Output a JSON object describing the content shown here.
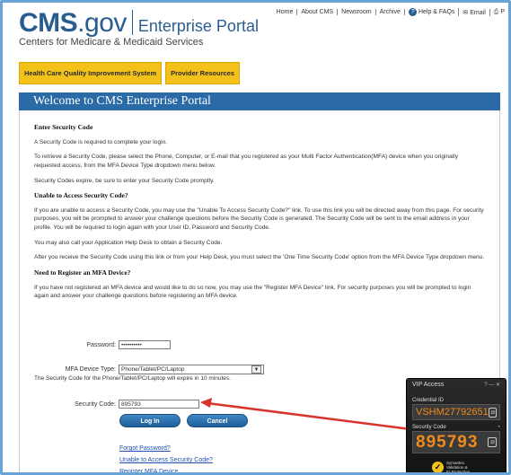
{
  "header": {
    "logo_cms": "CMS",
    "logo_gov": ".gov",
    "portal_title": "Enterprise Portal",
    "subtitle": "Centers for Medicare & Medicaid Services"
  },
  "topnav": {
    "home": "Home",
    "about": "About CMS",
    "newsroom": "Newsroom",
    "archive": "Archive",
    "help": "Help & FAQs",
    "email": "Email",
    "print": "P"
  },
  "tabs": [
    "Health Care Quality Improvement System",
    "Provider Resources"
  ],
  "banner": "Welcome to CMS Enterprise Portal",
  "content": {
    "h_enter": "Enter Security Code",
    "p1": "A Security Code is required to complete your login.",
    "p2": "To retrieve a Security Code, please select the Phone, Computer, or E-mail that you registered as your Multi Factor Authentication(MFA) device when you originally requested access, from the MFA Device Type dropdown menu below.",
    "p3": "Security Codes expire, be sure to enter your Security Code promptly.",
    "h_unable": "Unable to Access Security Code?",
    "p4": "If you are unable to access a Security Code, you may use the \"Unable To Access Security Code?\" link. To use this link you will be directed away from this page. For security purposes, you will be prompted to answer your challenge questions before the Security Code is generated. The Security Code will be sent to the email address in your profile. You will be required to login again with your User ID, Password and Security Code.",
    "p5": "You may also call your Application Help Desk to obtain a Security Code.",
    "p6": "After you receive the Security Code using this link or from your Help Desk, you must select the 'One Time Security Code' option from the MFA Device Type dropdown menu.",
    "h_register": "Need to Register an MFA Device?",
    "p7": "If you have not registered an MFA device and would like to do so now, you may use the \"Register MFA Device\" link. For security purposes you will be prompted to login again and answer your challenge questions before registering an MFA device."
  },
  "form": {
    "password_label": "Password:",
    "password_value": "••••••••••",
    "mfa_label": "MFA Device Type:",
    "mfa_value": "Phone/Tablet/PC/Laptop",
    "expire_note": "The Security Code for the Phone/Tablet/PC/Laptop will expire in 10 minutes.",
    "code_label": "Security Code:",
    "code_value": "895793",
    "login_button": "Log In",
    "cancel_button": "Cancel"
  },
  "links": [
    "Forgot Password?",
    "Unable to Access Security Code?",
    "Register MFA Device"
  ],
  "vip": {
    "title": "VIP Access",
    "controls": "? — ✕",
    "credential_label": "Credential ID",
    "credential_value": "VSHM27792651",
    "code_label": "Security Code",
    "code_value": "895793",
    "brand_line1": "Symantec.",
    "brand_line2": "Validation &",
    "brand_line3": "ID Protection"
  },
  "colors": {
    "brand_blue": "#2a5d8f",
    "banner_blue": "#2a6aa6",
    "tab_yellow": "#f3c21a",
    "arrow_red": "#d9342b",
    "vip_code_orange": "#f08a1c"
  }
}
